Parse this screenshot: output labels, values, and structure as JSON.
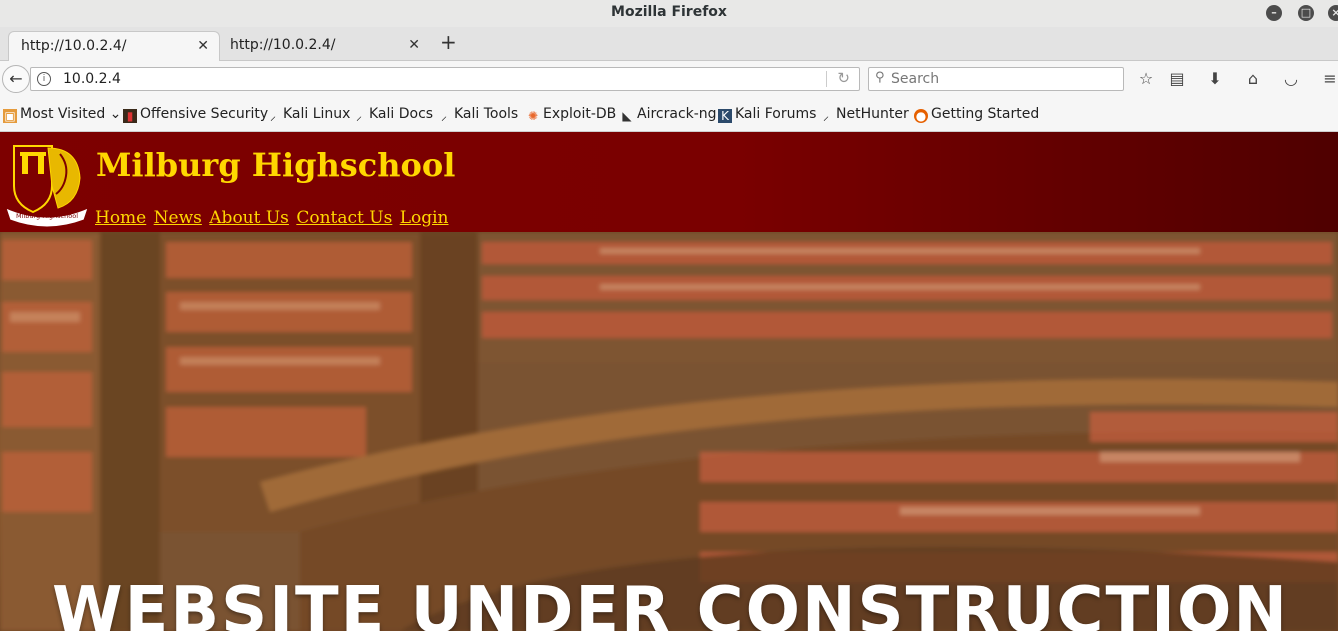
{
  "window": {
    "title": "Mozilla Firefox"
  },
  "tabs": [
    {
      "label": "http://10.0.2.4/",
      "active": true
    },
    {
      "label": "http://10.0.2.4/",
      "active": false
    }
  ],
  "toolbar": {
    "url": "10.0.2.4",
    "search_placeholder": "Search",
    "icons": [
      "back-icon",
      "info-icon",
      "reload-icon",
      "search-icon",
      "bookmark-star-icon",
      "reader-list-icon",
      "download-icon",
      "home-icon",
      "pocket-icon",
      "menu-icon"
    ]
  },
  "bookmarks": [
    {
      "label": "Most Visited",
      "icon": "folder-icon"
    },
    {
      "label": "Offensive Security",
      "icon": "offsec-icon"
    },
    {
      "label": "Kali Linux",
      "icon": "kali-icon"
    },
    {
      "label": "Kali Docs",
      "icon": "kali-icon"
    },
    {
      "label": "Kali Tools",
      "icon": "kali-icon"
    },
    {
      "label": "Exploit-DB",
      "icon": "exploitdb-icon"
    },
    {
      "label": "Aircrack-ng",
      "icon": "aircrack-icon"
    },
    {
      "label": "Kali Forums",
      "icon": "forums-icon"
    },
    {
      "label": "NetHunter",
      "icon": "kali-icon"
    },
    {
      "label": "Getting Started",
      "icon": "firefox-icon"
    }
  ],
  "site": {
    "title": "Milburg Highschool",
    "logo_text": "Milburg Highschool",
    "nav": [
      "Home",
      "News",
      "About Us",
      "Contact Us",
      "Login"
    ],
    "hero_heading": "WEBSITE UNDER CONSTRUCTION",
    "colors": {
      "header": "#7d0000",
      "accent": "#ffd700"
    }
  }
}
